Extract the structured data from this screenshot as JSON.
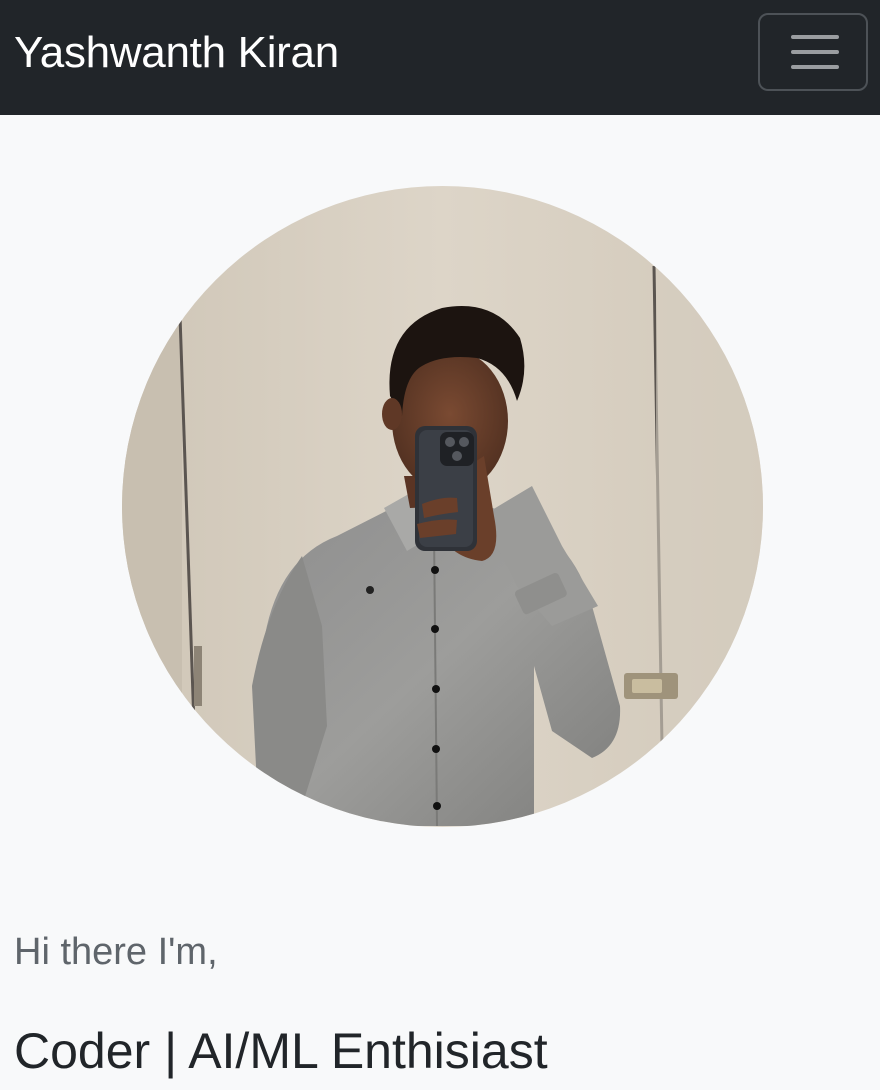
{
  "navbar": {
    "brand": "Yashwanth Kiran",
    "toggle_icon": "hamburger-menu-icon",
    "background": "#212529"
  },
  "hero": {
    "avatar": "profile-photo",
    "greeting": "Hi there I'm,",
    "tagline": "Coder | AI/ML Enthisiast"
  },
  "colors": {
    "page_background": "#f8f9fa",
    "brand_text": "#ffffff",
    "greeting_text": "#5f656b",
    "tagline_text": "#212529"
  }
}
